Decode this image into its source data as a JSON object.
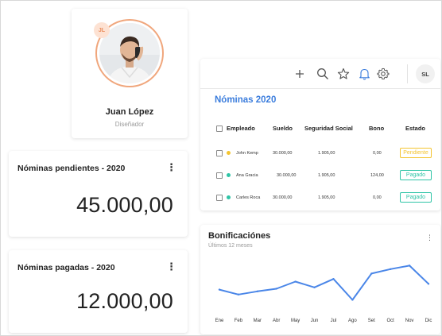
{
  "profile": {
    "initials": "JL",
    "name": "Juan López",
    "role": "Diseñador",
    "accent_color": "#f0a67c"
  },
  "stats": {
    "pending": {
      "title": "Nóminas pendientes - 2020",
      "value": "45.000,00"
    },
    "paid": {
      "title": "Nóminas pagadas - 2020",
      "value": "12.000,00"
    }
  },
  "toolbar": {
    "icons": [
      "plus-icon",
      "search-icon",
      "star-icon",
      "bell-icon",
      "gear-icon"
    ],
    "user_initials": "SL"
  },
  "payroll": {
    "title": "Nóminas 2020",
    "headers": [
      "Empleado",
      "Sueldo",
      "Seguridad Social",
      "Bono",
      "Estado"
    ],
    "rows": [
      {
        "name": "John Kemp",
        "salary": "30.000,00",
        "social": "1.905,00",
        "bonus": "0,00",
        "status": "Pendiente",
        "dot_color": "#f4c430",
        "status_color": "#f4c430"
      },
      {
        "name": "Ana Gracia",
        "salary": "30.000,00",
        "social": "1.905,00",
        "bonus": "124,00",
        "status": "Pagado",
        "dot_color": "#2ec4a6",
        "status_color": "#2ec4a6"
      },
      {
        "name": "Carles Roca",
        "salary": "30.000,00",
        "social": "1.905,00",
        "bonus": "0,00",
        "status": "Pagado",
        "dot_color": "#2ec4a6",
        "status_color": "#2ec4a6"
      }
    ]
  },
  "bonus": {
    "title": "Bonificaciónes",
    "subtitle": "Últimos 12 meses"
  },
  "chart_data": {
    "type": "line",
    "categories": [
      "Ene",
      "Feb",
      "Mar",
      "Abr",
      "May",
      "Jun",
      "Jul",
      "Ago",
      "Set",
      "Oct",
      "Nov",
      "Dic"
    ],
    "values": [
      40,
      29,
      36,
      42,
      58,
      45,
      64,
      17,
      76,
      86,
      94,
      53
    ],
    "ylim": [
      0,
      100
    ],
    "color": "#4a86e8",
    "grid": false,
    "title": "Bonificaciónes",
    "xlabel": "",
    "ylabel": ""
  }
}
